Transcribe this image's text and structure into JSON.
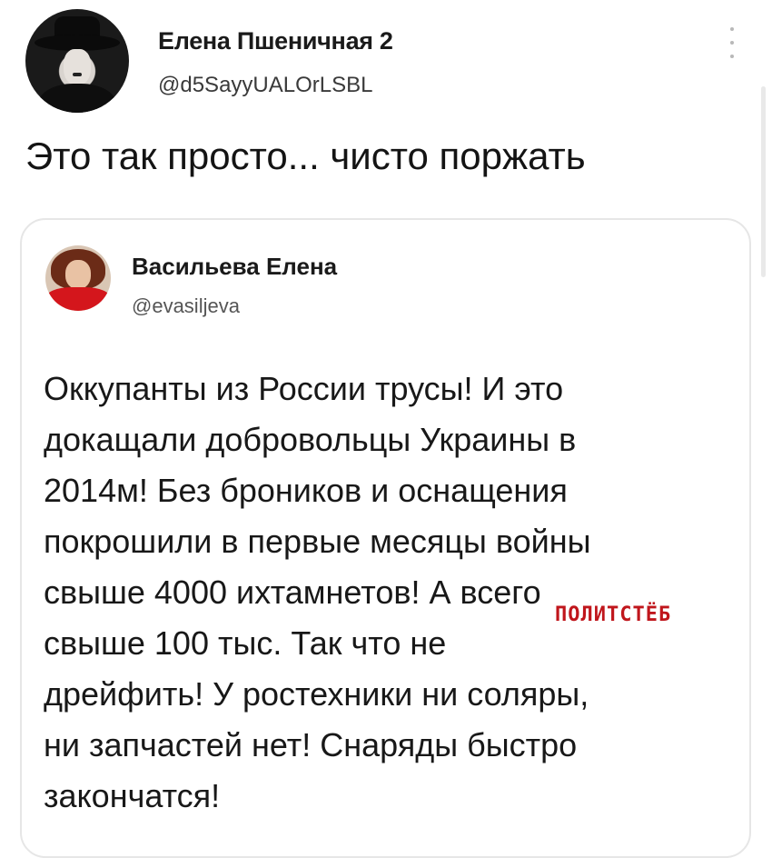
{
  "tweet": {
    "author_name": "Елена Пшеничная 2",
    "author_handle": "@d5SayyUALOrLSBL",
    "text": "Это так просто... чисто поржать"
  },
  "quoted_tweet": {
    "author_name": "Васильева Елена",
    "author_handle": "@evasiljeva",
    "lines": [
      "Оккупанты из России трусы! И это",
      "докащали добровольцы Украины в",
      "2014м! Без броников и оснащения",
      "покрошили в первые месяцы войны",
      "свыше 4000 ихтамнетов! А всего",
      "свыше 100 тыс. Так что не",
      "дрейфить! У ростехники ни соляры,",
      "ни запчастей нет! Снаряды быстро",
      "закончатся!"
    ]
  },
  "watermark": "ПОЛИТСТЁБ",
  "icons": {
    "more": "more-vertical-icon"
  },
  "colors": {
    "watermark": "#c0161c",
    "card_border": "#e6e6e6"
  }
}
